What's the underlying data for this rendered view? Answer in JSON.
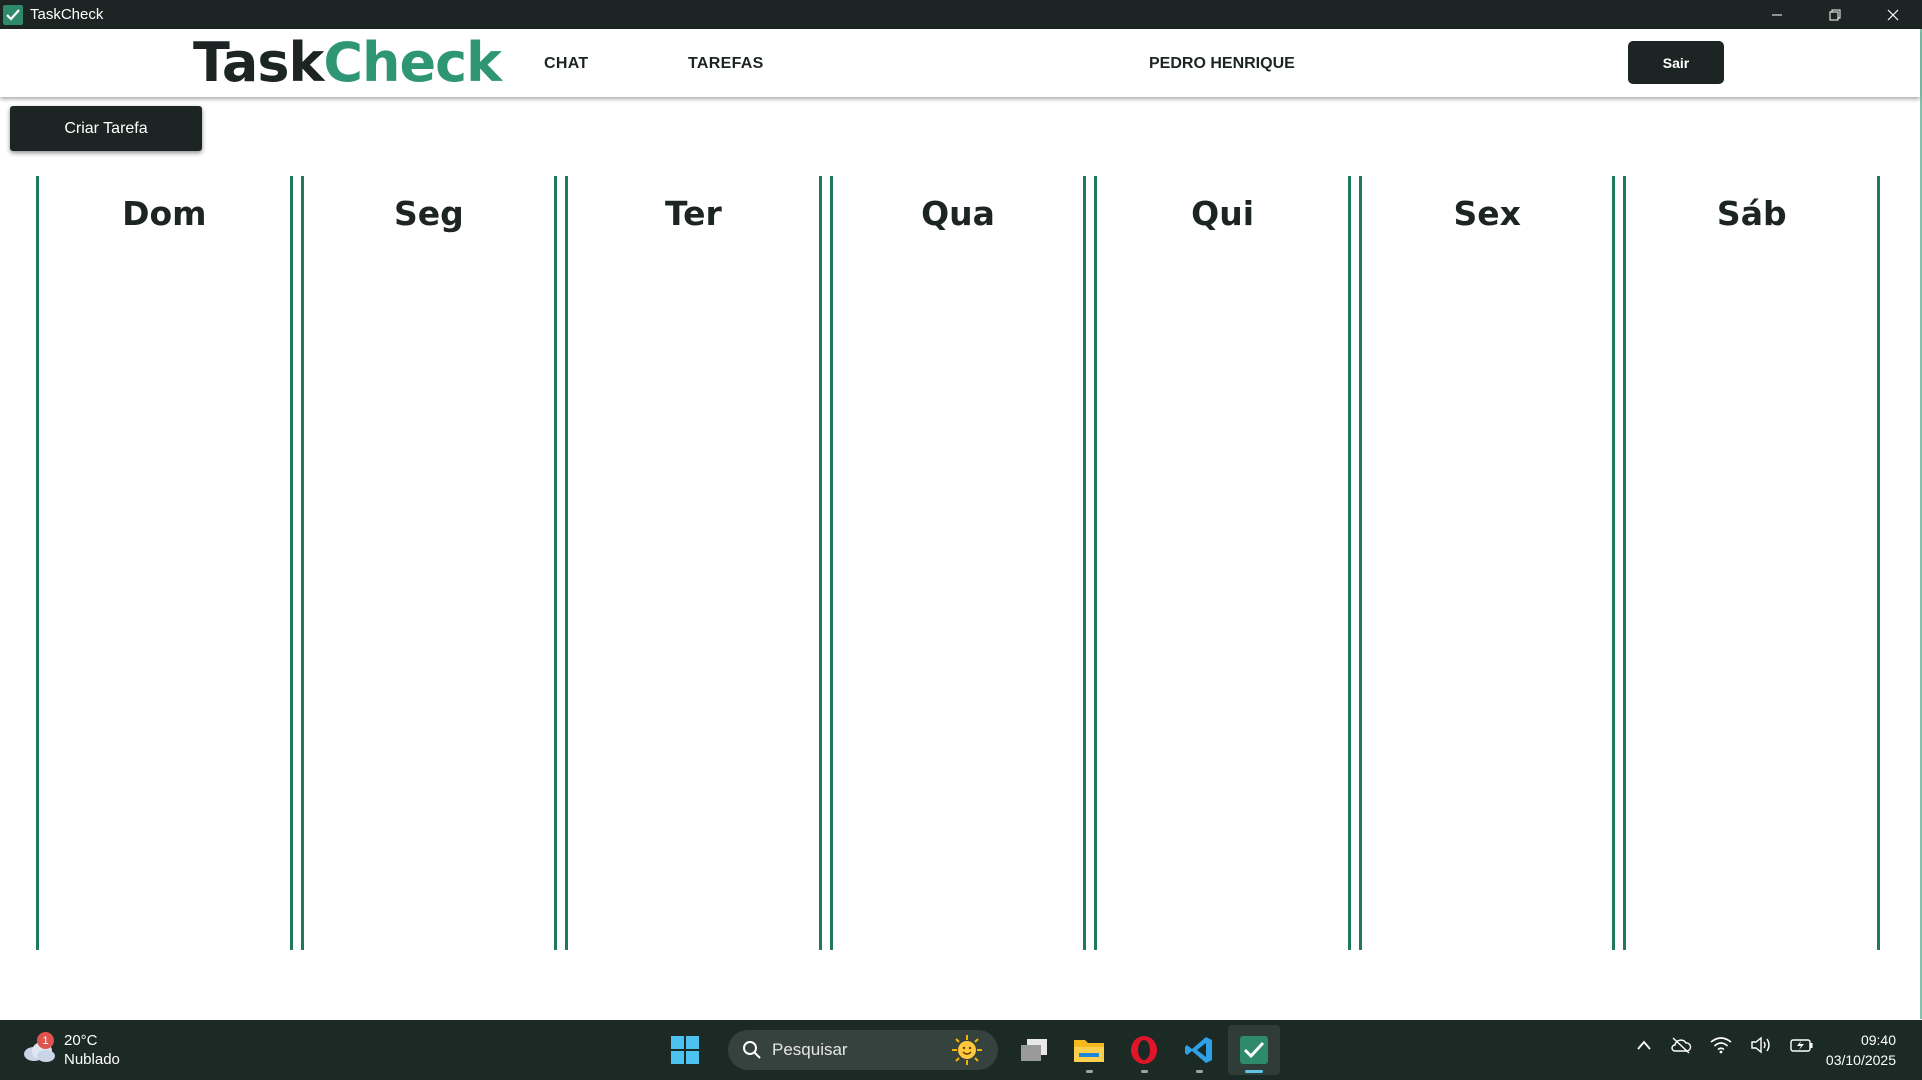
{
  "window": {
    "title": "TaskCheck"
  },
  "header": {
    "logo_part1": "Task",
    "logo_part2": "Check",
    "nav": {
      "chat": "CHAT",
      "tarefas": "TAREFAS"
    },
    "user_name": "PEDRO HENRIQUE",
    "logout_label": "Sair"
  },
  "actions": {
    "create_task_label": "Criar Tarefa"
  },
  "board": {
    "days": [
      "Dom",
      "Seg",
      "Ter",
      "Qua",
      "Qui",
      "Sex",
      "Sáb"
    ]
  },
  "taskbar": {
    "weather": {
      "temp": "20°C",
      "condition": "Nublado",
      "badge": "1"
    },
    "search_placeholder": "Pesquisar",
    "time": "09:40",
    "date": "03/10/2025",
    "apps": [
      "task-view-icon",
      "file-explorer-icon",
      "opera-icon",
      "vscode-icon",
      "taskcheck-icon"
    ]
  },
  "colors": {
    "dark": "#1c2523",
    "accent": "#2e9675",
    "column_border": "#1e7a5b"
  }
}
